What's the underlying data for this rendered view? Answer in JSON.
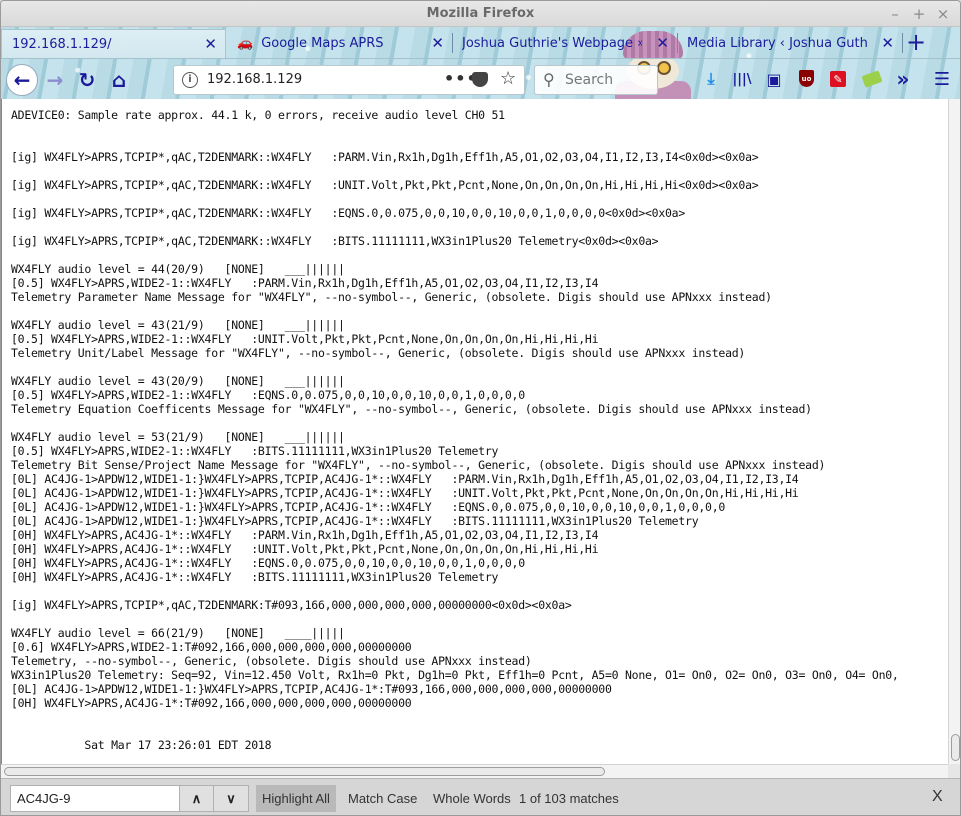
{
  "window": {
    "title": "Mozilla Firefox",
    "controls": {
      "minimize": "–",
      "maximize": "+",
      "close": "×"
    }
  },
  "tabs": [
    {
      "label": "192.168.1.129/",
      "active": true,
      "icon": ""
    },
    {
      "label": "Google Maps APRS",
      "active": false,
      "icon": "car-icon"
    },
    {
      "label": "Joshua Guthrie's Webpage » Ne",
      "active": false,
      "icon": ""
    },
    {
      "label": "Media Library ‹ Joshua Guthrie's",
      "active": false,
      "icon": ""
    }
  ],
  "tab_close_glyph": "✕",
  "new_tab_glyph": "+",
  "navbar": {
    "back_glyph": "←",
    "forward_glyph": "→",
    "reload_glyph": "↻",
    "home_glyph": "⌂",
    "url": "192.168.1.129",
    "info_glyph": "i",
    "page_actions_glyph": "•••",
    "star_glyph": "☆",
    "search_placeholder": "Search",
    "search_glyph": "⚲",
    "toolbar_icons": {
      "download": "⤓",
      "library": "|||\\",
      "sidebar": "▣",
      "ublock": "uo",
      "wand": "✎",
      "overflow": "»",
      "menu": "☰"
    }
  },
  "log_lines": [
    "ADEVICE0: Sample rate approx. 44.1 k, 0 errors, receive audio level CH0 51",
    "",
    "",
    "[ig] WX4FLY>APRS,TCPIP*,qAC,T2DENMARK::WX4FLY   :PARM.Vin,Rx1h,Dg1h,Eff1h,A5,O1,O2,O3,O4,I1,I2,I3,I4<0x0d><0x0a>",
    "",
    "[ig] WX4FLY>APRS,TCPIP*,qAC,T2DENMARK::WX4FLY   :UNIT.Volt,Pkt,Pkt,Pcnt,None,On,On,On,On,Hi,Hi,Hi,Hi<0x0d><0x0a>",
    "",
    "[ig] WX4FLY>APRS,TCPIP*,qAC,T2DENMARK::WX4FLY   :EQNS.0,0.075,0,0,10,0,0,10,0,0,1,0,0,0,0<0x0d><0x0a>",
    "",
    "[ig] WX4FLY>APRS,TCPIP*,qAC,T2DENMARK::WX4FLY   :BITS.11111111,WX3in1Plus20 Telemetry<0x0d><0x0a>",
    "",
    "WX4FLY audio level = 44(20/9)   [NONE]   ___||||||",
    "[0.5] WX4FLY>APRS,WIDE2-1::WX4FLY   :PARM.Vin,Rx1h,Dg1h,Eff1h,A5,O1,O2,O3,O4,I1,I2,I3,I4",
    "Telemetry Parameter Name Message for \"WX4FLY\", --no-symbol--, Generic, (obsolete. Digis should use APNxxx instead)",
    "",
    "WX4FLY audio level = 43(21/9)   [NONE]   ___||||||",
    "[0.5] WX4FLY>APRS,WIDE2-1::WX4FLY   :UNIT.Volt,Pkt,Pkt,Pcnt,None,On,On,On,On,Hi,Hi,Hi,Hi",
    "Telemetry Unit/Label Message for \"WX4FLY\", --no-symbol--, Generic, (obsolete. Digis should use APNxxx instead)",
    "",
    "WX4FLY audio level = 43(20/9)   [NONE]   ___||||||",
    "[0.5] WX4FLY>APRS,WIDE2-1::WX4FLY   :EQNS.0,0.075,0,0,10,0,0,10,0,0,1,0,0,0,0",
    "Telemetry Equation Coefficents Message for \"WX4FLY\", --no-symbol--, Generic, (obsolete. Digis should use APNxxx instead)",
    "",
    "WX4FLY audio level = 53(21/9)   [NONE]   ___||||||",
    "[0.5] WX4FLY>APRS,WIDE2-1::WX4FLY   :BITS.11111111,WX3in1Plus20 Telemetry",
    "Telemetry Bit Sense/Project Name Message for \"WX4FLY\", --no-symbol--, Generic, (obsolete. Digis should use APNxxx instead)",
    "[0L] AC4JG-1>APDW12,WIDE1-1:}WX4FLY>APRS,TCPIP,AC4JG-1*::WX4FLY   :PARM.Vin,Rx1h,Dg1h,Eff1h,A5,O1,O2,O3,O4,I1,I2,I3,I4",
    "[0L] AC4JG-1>APDW12,WIDE1-1:}WX4FLY>APRS,TCPIP,AC4JG-1*::WX4FLY   :UNIT.Volt,Pkt,Pkt,Pcnt,None,On,On,On,On,Hi,Hi,Hi,Hi",
    "[0L] AC4JG-1>APDW12,WIDE1-1:}WX4FLY>APRS,TCPIP,AC4JG-1*::WX4FLY   :EQNS.0,0.075,0,0,10,0,0,10,0,0,1,0,0,0,0",
    "[0L] AC4JG-1>APDW12,WIDE1-1:}WX4FLY>APRS,TCPIP,AC4JG-1*::WX4FLY   :BITS.11111111,WX3in1Plus20 Telemetry",
    "[0H] WX4FLY>APRS,AC4JG-1*::WX4FLY   :PARM.Vin,Rx1h,Dg1h,Eff1h,A5,O1,O2,O3,O4,I1,I2,I3,I4",
    "[0H] WX4FLY>APRS,AC4JG-1*::WX4FLY   :UNIT.Volt,Pkt,Pkt,Pcnt,None,On,On,On,On,Hi,Hi,Hi,Hi",
    "[0H] WX4FLY>APRS,AC4JG-1*::WX4FLY   :EQNS.0,0.075,0,0,10,0,0,10,0,0,1,0,0,0,0",
    "[0H] WX4FLY>APRS,AC4JG-1*::WX4FLY   :BITS.11111111,WX3in1Plus20 Telemetry",
    "",
    "[ig] WX4FLY>APRS,TCPIP*,qAC,T2DENMARK:T#093,166,000,000,000,000,00000000<0x0d><0x0a>",
    "",
    "WX4FLY audio level = 66(21/9)   [NONE]   ____|||||",
    "[0.6] WX4FLY>APRS,WIDE2-1:T#092,166,000,000,000,000,00000000",
    "Telemetry, --no-symbol--, Generic, (obsolete. Digis should use APNxxx instead)",
    "WX3in1Plus20 Telemetry: Seq=92, Vin=12.450 Volt, Rx1h=0 Pkt, Dg1h=0 Pkt, Eff1h=0 Pcnt, A5=0 None, O1= On0, O2= On0, O3= On0, O4= On0,",
    "[0L] AC4JG-1>APDW12,WIDE1-1:}WX4FLY>APRS,TCPIP,AC4JG-1*:T#093,166,000,000,000,000,00000000",
    "[0H] WX4FLY>APRS,AC4JG-1*:T#092,166,000,000,000,000,00000000",
    "",
    "",
    "           Sat Mar 17 23:26:01 EDT 2018"
  ],
  "findbar": {
    "query": "AC4JG-9",
    "prev_glyph": "∧",
    "next_glyph": "∨",
    "highlight_all": "Highlight All",
    "highlight_all_active": true,
    "match_case": "Match Case",
    "whole_words": "Whole Words",
    "status": "1 of 103 matches",
    "close_glyph": "X"
  }
}
